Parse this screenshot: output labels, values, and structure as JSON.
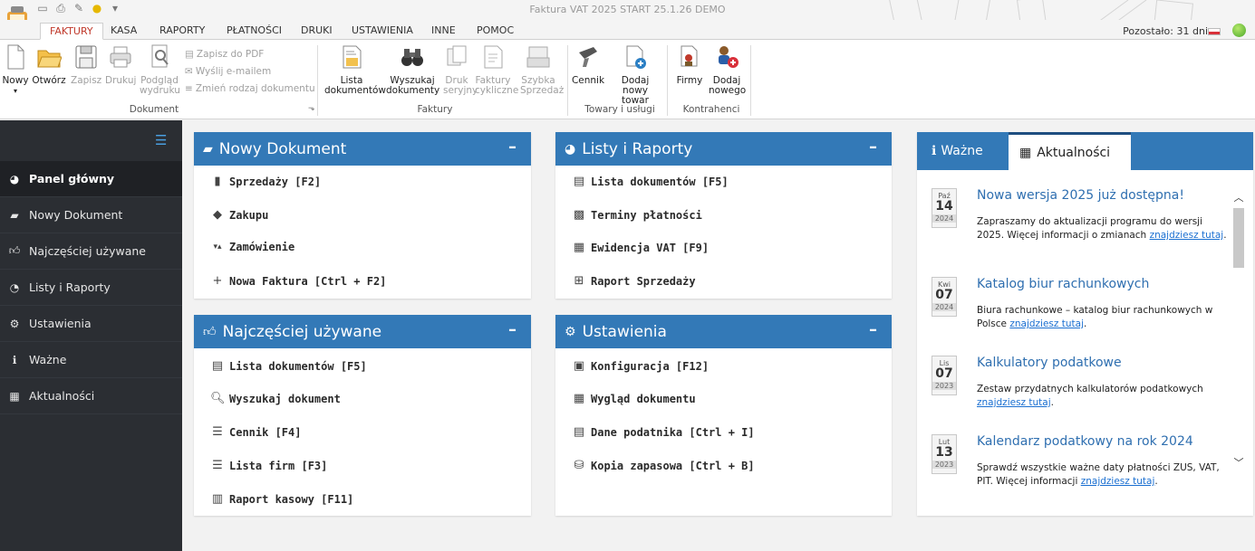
{
  "window": {
    "title": "Faktura VAT 2025 START 25.1.26 DEMO"
  },
  "menu_tabs": [
    "FAKTURY",
    "KASA",
    "RAPORTY",
    "PŁATNOŚCI",
    "DRUKI",
    "USTAWIENIA",
    "INNE",
    "POMOC"
  ],
  "status": {
    "remaining": "Pozostało: 31 dni"
  },
  "ribbon": {
    "doc_buttons": [
      "Nowy",
      "Otwórz",
      "Zapisz",
      "Drukuj",
      "Podgląd wydruku"
    ],
    "small_actions": [
      "Zapisz do PDF",
      "Wyślij e-mailem",
      "Zmień rodzaj dokumentu"
    ],
    "group_dokument": "Dokument",
    "faktury_buttons": [
      "Lista dokumentów",
      "Wyszukaj dokumenty",
      "Druk seryjny",
      "Faktury cykliczne",
      "Szybka Sprzedaż"
    ],
    "group_faktury": "Faktury",
    "towary_buttons": [
      "Cennik",
      "Dodaj nowy towar"
    ],
    "group_towary": "Towary i usługi",
    "kontrahenci_buttons": [
      "Firmy",
      "Dodaj nowego"
    ],
    "group_kontrahenci": "Kontrahenci"
  },
  "sidebar": {
    "items": [
      {
        "label": "Panel główny",
        "icon": "dashboard-icon",
        "active": true
      },
      {
        "label": "Nowy Dokument",
        "icon": "book-icon"
      },
      {
        "label": "Najczęściej używane",
        "icon": "thumbs-up-icon"
      },
      {
        "label": "Listy i Raporty",
        "icon": "pie-chart-icon"
      },
      {
        "label": "Ustawienia",
        "icon": "gears-icon"
      },
      {
        "label": "Ważne",
        "icon": "info-icon"
      },
      {
        "label": "Aktualności",
        "icon": "newspaper-icon"
      }
    ]
  },
  "panels": {
    "nowy_dokument": {
      "title": "Nowy Dokument",
      "items": [
        "Sprzedaży [F2]",
        "Zakupu",
        "Zamówienie",
        "Nowa Faktura [Ctrl + F2]"
      ]
    },
    "listy_raporty": {
      "title": "Listy i Raporty",
      "items": [
        "Lista dokumentów [F5]",
        "Terminy płatności",
        "Ewidencja VAT [F9]",
        "Raport Sprzedaży"
      ]
    },
    "najczesciej": {
      "title": "Najczęściej używane",
      "items": [
        "Lista dokumentów [F5]",
        "Wyszukaj dokument",
        "Cennik [F4]",
        "Lista firm [F3]",
        "Raport kasowy [F11]"
      ]
    },
    "ustawienia": {
      "title": "Ustawienia",
      "items": [
        "Konfiguracja [F12]",
        "Wygląd dokumentu",
        "Dane podatnika [Ctrl + I]",
        "Kopia zapasowa [Ctrl + B]"
      ]
    }
  },
  "news": {
    "tabs": [
      "Ważne",
      "Aktualności"
    ],
    "link_text": "znajdziesz tutaj",
    "items": [
      {
        "month": "Paź",
        "day": "14",
        "year": "2024",
        "title": "Nowa wersja 2025 już dostępna!",
        "body": "Zapraszamy do aktualizacji programu do wersji 2025. Więcej informacji o zmianach",
        "link": "znajdziesz tutaj",
        "tail": "."
      },
      {
        "month": "Kwi",
        "day": "07",
        "year": "2024",
        "title": "Katalog biur rachunkowych",
        "body": "Biura rachunkowe – katalog biur rachunkowych w Polsce",
        "link": "znajdziesz tutaj",
        "tail": "."
      },
      {
        "month": "Lis",
        "day": "07",
        "year": "2023",
        "title": "Kalkulatory podatkowe",
        "body": "Zestaw przydatnych kalkulatorów podatkowych",
        "link": "znajdziesz tutaj",
        "tail": "."
      },
      {
        "month": "Lut",
        "day": "13",
        "year": "2023",
        "title": "Kalendarz podatkowy na rok 2024",
        "body": "Sprawdź wszystkie ważne daty płatności ZUS, VAT, PIT. Więcej informacji",
        "link": "znajdziesz tutaj",
        "tail": "."
      }
    ]
  },
  "colors": {
    "accent": "#3379b7",
    "sidebar": "#2b2e33",
    "active_tab": "#c0392b",
    "link": "#1a6fd1"
  }
}
